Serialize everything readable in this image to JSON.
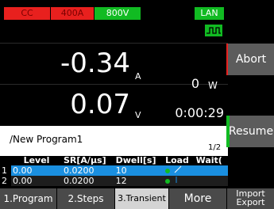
{
  "status": {
    "mode_badge": "CC",
    "current_range_badge": "400A",
    "voltage_range_badge": "800V",
    "lan_badge": "LAN",
    "colors": {
      "red": "#e8201e",
      "green": "#11bb22"
    }
  },
  "readings": {
    "current_value": "-0.34",
    "current_unit": "A",
    "voltage_value": "0.07",
    "voltage_unit": "V",
    "power_value": "0",
    "power_unit": "W",
    "elapsed_time": "0:00:29"
  },
  "program": {
    "name": "/New Program1",
    "page": "1/2"
  },
  "table": {
    "headers": [
      "Level",
      "SR[A/μs]",
      "Dwell[s]",
      "Load",
      "Wait("
    ],
    "rows": [
      {
        "index": "1",
        "level": "0.00",
        "sr": "0.0200",
        "dwell": "10"
      },
      {
        "index": "2",
        "level": "0.00",
        "sr": "0.0200",
        "dwell": "12"
      }
    ]
  },
  "side_buttons": {
    "abort": "Abort",
    "resume": "Resume"
  },
  "tabs": [
    {
      "label": "1.Program"
    },
    {
      "label": "2.Steps"
    },
    {
      "label": "3.Transient"
    },
    {
      "label": "More"
    },
    {
      "label": "Import\nExport"
    }
  ],
  "icons": {
    "wave_icon": "square-wave-icon"
  }
}
